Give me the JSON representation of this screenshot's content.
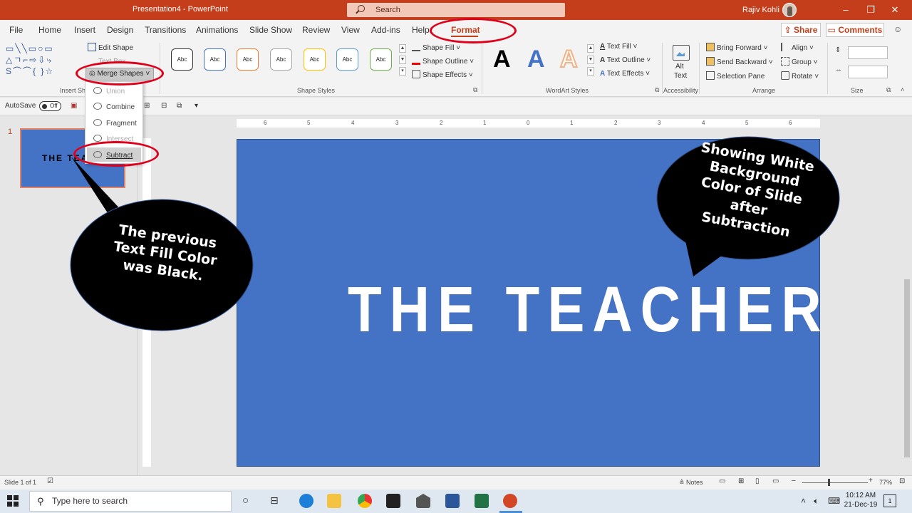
{
  "title_bar": {
    "document_title": "Presentation4  -  PowerPoint",
    "search_placeholder": "Search",
    "user_name": "Rajiv Kohli",
    "minimize": "–",
    "restore": "❐",
    "close": "✕"
  },
  "tabs": [
    "File",
    "Home",
    "Insert",
    "Design",
    "Transitions",
    "Animations",
    "Slide Show",
    "Review",
    "View",
    "Add-ins",
    "Help",
    "Format"
  ],
  "active_tab": "Format",
  "share_label": "Share",
  "comments_label": "Comments",
  "ribbon": {
    "insert_shapes": {
      "shape_glyphs_row1": "▭╲╲▭○▭",
      "shape_glyphs_row2": "△ㄱ⌐⇨⇩⤷",
      "shape_glyphs_row3": "S⌒⌒{ }☆",
      "edit_shape": "Edit Shape",
      "text_box": "Text Box",
      "merge_shapes": "Merge Shapes",
      "group_label": "Insert Sha"
    },
    "shape_styles": {
      "gallery_labels": [
        "Abc",
        "Abc",
        "Abc",
        "Abc",
        "Abc",
        "Abc",
        "Abc"
      ],
      "gallery_border_colors": [
        "#333333",
        "#4472c4",
        "#ed7d31",
        "#a5a5a5",
        "#ffc000",
        "#5b9bd5",
        "#70ad47"
      ],
      "shape_fill": "Shape Fill",
      "shape_outline": "Shape Outline",
      "shape_effects": "Shape Effects",
      "group_label": "Shape Styles"
    },
    "wordart_styles": {
      "samples": [
        "A",
        "A",
        "A"
      ],
      "sample_colors": [
        "#000000",
        "#4472c4",
        "#f4b183"
      ],
      "text_fill": "Text Fill",
      "text_outline": "Text Outline",
      "text_effects": "Text Effects",
      "group_label": "WordArt Styles"
    },
    "accessibility": {
      "alt_text_line1": "Alt",
      "alt_text_line2": "Text",
      "group_label": "Accessibility"
    },
    "arrange": {
      "bring_forward": "Bring Forward",
      "send_backward": "Send Backward",
      "selection_pane": "Selection Pane",
      "align": "Align",
      "group": "Group",
      "rotate": "Rotate",
      "group_label": "Arrange"
    },
    "size": {
      "group_label": "Size"
    }
  },
  "qat": {
    "autosave_label": "AutoSave",
    "autosave_state": "Off"
  },
  "merge_menu": {
    "items": [
      "Union",
      "Combine",
      "Fragment",
      "Intersect",
      "Subtract"
    ],
    "highlighted": "Subtract"
  },
  "thumbnail": {
    "slide_number": "1",
    "text": "THE TEAC"
  },
  "ruler_labels": [
    "6",
    "5",
    "4",
    "3",
    "2",
    "1",
    "0",
    "1",
    "2",
    "3",
    "4",
    "5",
    "6"
  ],
  "slide": {
    "title": "THE TEACHER",
    "background_color": "#4472c4"
  },
  "callouts": {
    "left": [
      "The previous",
      "Text Fill Color",
      "was Black."
    ],
    "right": [
      "Showing White",
      "Background",
      "Color of Slide",
      "after",
      "Subtraction"
    ]
  },
  "status_bar": {
    "slide_info": "Slide 1 of 1",
    "notes": "Notes",
    "zoom": "77%",
    "zoom_minus": "–",
    "zoom_plus": "+"
  },
  "taskbar": {
    "search_placeholder": "Type here to search",
    "time": "10:12 AM",
    "date": "21-Dec-19",
    "notification_count": "1"
  }
}
